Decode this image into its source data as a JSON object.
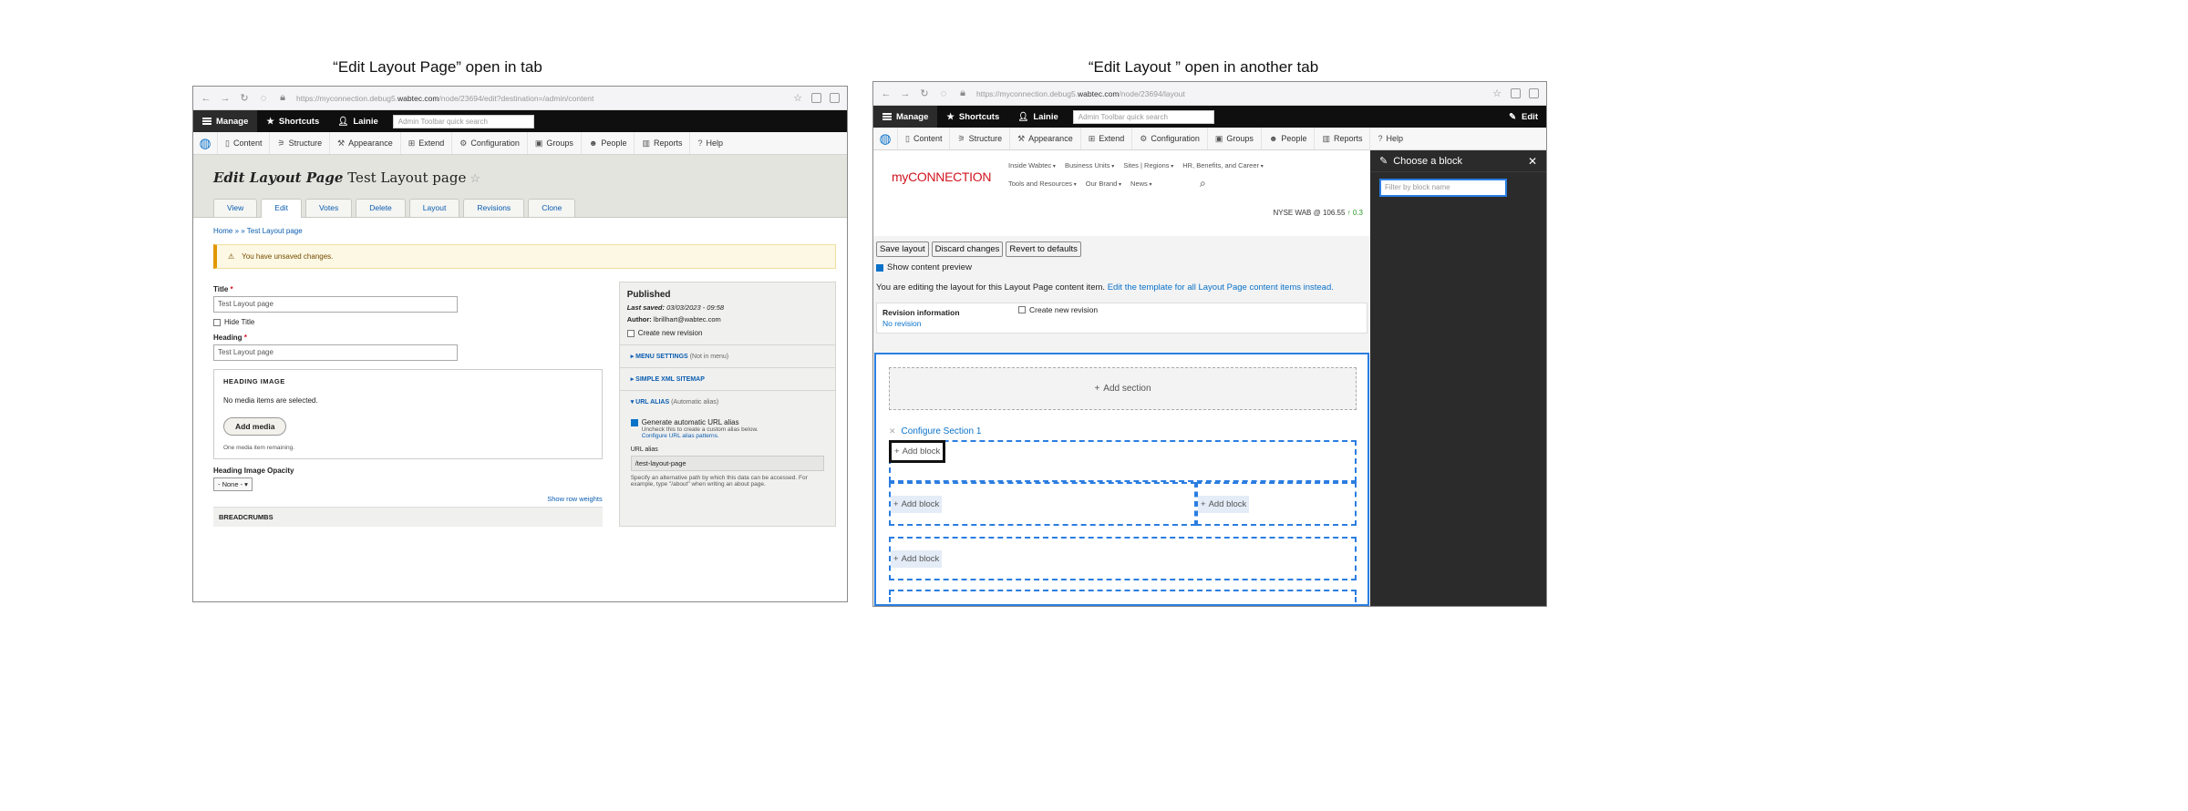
{
  "captions": {
    "left": "“Edit Layout Page” open in tab",
    "right": "“Edit Layout ” open in another tab"
  },
  "tab1": {
    "url_pre": "https://myconnection.debug5.",
    "url_host": "wabtec.com",
    "url_post": "/node/23694/edit?destination=/admin/content",
    "toolbar": {
      "manage": "Manage",
      "shortcuts": "Shortcuts",
      "user": "Lainie",
      "search_placeholder": "Admin Toolbar quick search"
    },
    "menu": [
      "Content",
      "Structure",
      "Appearance",
      "Extend",
      "Configuration",
      "Groups",
      "People",
      "Reports",
      "Help"
    ],
    "title_italic": "Edit Layout Page",
    "title_rest": " Test Layout page",
    "tabs": [
      "View",
      "Edit",
      "Votes",
      "Delete",
      "Layout",
      "Revisions",
      "Clone"
    ],
    "breadcrumb": "Home » » Test Layout page",
    "warning": "You have unsaved changes.",
    "title_label": "Title",
    "title_value": "Test Layout page",
    "hide_title": "Hide Title",
    "heading_label": "Heading",
    "heading_value": "Test Layout page",
    "heading_image": "HEADING IMAGE",
    "no_media": "No media items are selected.",
    "add_media": "Add media",
    "media_remaining": "One media item remaining.",
    "opacity_label": "Heading Image Opacity",
    "opacity_value": "- None -",
    "show_row_weights": "Show row weights",
    "breadcrumbs": "BREADCRUMBS",
    "published": "Published",
    "last_saved_label": "Last saved:",
    "last_saved": "03/03/2023 - 09:58",
    "author_label": "Author:",
    "author": "lbrillhart@wabtec.com",
    "new_revision": "Create new revision",
    "menu_settings": "MENU SETTINGS",
    "menu_settings_meta": "(Not in menu)",
    "xml_sitemap": "SIMPLE XML SITEMAP",
    "url_alias": "URL ALIAS",
    "url_alias_meta": "(Automatic alias)",
    "gen_alias": "Generate automatic URL alias",
    "gen_desc": "Uncheck this to create a custom alias below.",
    "configure_patterns": "Configure URL alias patterns.",
    "alias_label": "URL alias",
    "alias_value": "/test-layout-page",
    "alias_desc": "Specify an alternative path by which this data can be accessed. For example, type \"/about\" when writing an about page."
  },
  "tab2": {
    "url_pre": "https://myconnection.debug5.",
    "url_host": "wabtec.com",
    "url_post": "/node/23694/layout",
    "toolbar": {
      "manage": "Manage",
      "shortcuts": "Shortcuts",
      "user": "Lainie",
      "search_placeholder": "Admin Toolbar quick search",
      "edit": "Edit"
    },
    "menu": [
      "Content",
      "Structure",
      "Appearance",
      "Extend",
      "Configuration",
      "Groups",
      "People",
      "Reports",
      "Help"
    ],
    "logo_my": "my",
    "logo_rest": "CONNECTION",
    "site_nav_1": [
      "Inside Wabtec",
      "Business Units",
      "Sites | Regions",
      "HR, Benefits, and Career"
    ],
    "site_nav_2": [
      "Tools and Resources",
      "Our Brand",
      "News"
    ],
    "nyse": "NYSE WAB @ 106.55",
    "nyse_change": "↑ 0.3",
    "buttons": [
      "Save layout",
      "Discard changes",
      "Revert to defaults"
    ],
    "show_preview": "Show content preview",
    "editing_text": "You are editing the layout for this Layout Page content item.",
    "editing_link": "Edit the template for all Layout Page content items instead.",
    "revision_info": "Revision information",
    "no_revision": "No revision",
    "create_revision": "Create new revision",
    "add_section": "Add section",
    "configure_section": "Configure Section 1",
    "add_block": "Add block",
    "sidebar_title": "Choose a block",
    "filter_placeholder": "Filter by block name"
  }
}
